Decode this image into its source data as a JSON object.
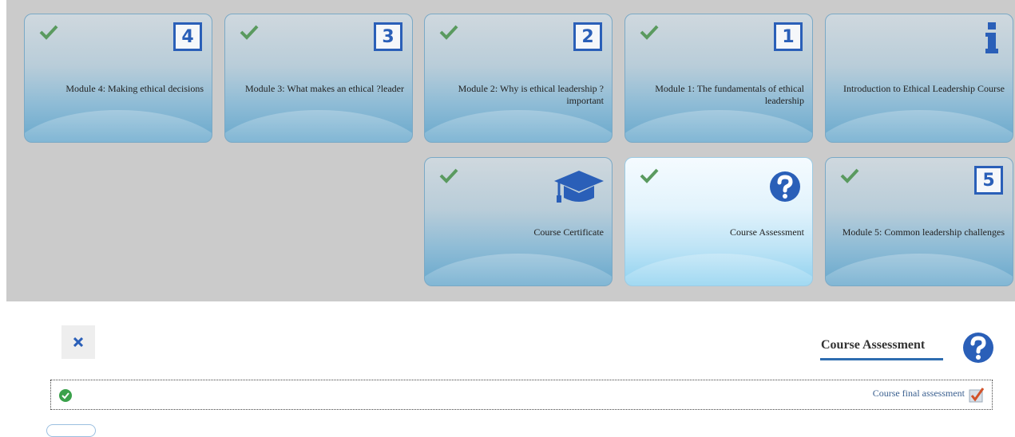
{
  "tiles_row1": [
    {
      "label": "Module 4: Making ethical decisions",
      "number": "4"
    },
    {
      "label": "Module 3: What makes an ethical ?leader",
      "number": "3"
    },
    {
      "label": "Module 2: Why is ethical leadership ?important",
      "number": "2"
    },
    {
      "label": "Module 1: The fundamentals of ethical leadership",
      "number": "1"
    },
    {
      "label": "Introduction to Ethical Leadership Course",
      "icon": "info-icon"
    }
  ],
  "tiles_row2": [
    {
      "label": "Course Certificate",
      "icon": "graduation-cap-icon"
    },
    {
      "label": "Course Assessment",
      "icon": "question-circle-icon",
      "active": true
    },
    {
      "label": "Module 5: Common leadership challenges",
      "number": "5"
    }
  ],
  "panel": {
    "title": "Course Assessment",
    "item_link": "Course final assessment"
  },
  "colors": {
    "accent_blue": "#2a5fb8",
    "check_green": "#5a9a5f",
    "ok_green": "#3aa14b"
  }
}
